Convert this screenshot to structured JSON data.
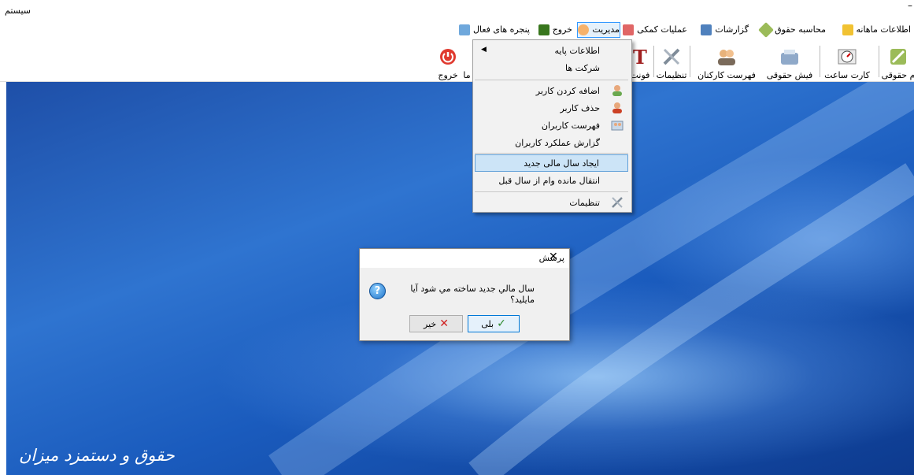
{
  "window": {
    "title": "سيستم",
    "minimize": "–"
  },
  "menu": [
    {
      "label": "اطلاعات ماهانه",
      "icon": "monthly-info-icon",
      "color": "#f1c232"
    },
    {
      "label": "محاسبه حقوق",
      "icon": "salary-calc-icon",
      "color": "#9bbb59"
    },
    {
      "label": "گزارشات",
      "icon": "reports-icon",
      "color": "#4f81bd"
    },
    {
      "label": "عمليات کمکی",
      "icon": "helper-ops-icon",
      "color": "#e06666"
    },
    {
      "label": "مديريت",
      "icon": "management-icon",
      "color": "#f6b26b"
    },
    {
      "label": "خروج",
      "icon": "exit-icon",
      "color": "#38761d"
    },
    {
      "label": "پنجره هاى فعال",
      "icon": "active-windows-icon",
      "color": "#6fa8dc"
    }
  ],
  "toolbar": [
    {
      "label": "م حقوقی",
      "icon": "edit-pencil-icon"
    },
    {
      "label": "کارت ساعت",
      "icon": "time-card-icon"
    },
    {
      "label": "فیش حقوقی",
      "icon": "payslip-icon"
    },
    {
      "label": "فهرست کارکنان",
      "icon": "staff-list-icon"
    },
    {
      "label": "تنظیمات",
      "icon": "settings-tools-icon"
    },
    {
      "label": "فونت",
      "icon": "font-icon"
    },
    {
      "label": "ما",
      "icon": ""
    },
    {
      "label": "خروج",
      "icon": "power-icon"
    }
  ],
  "dropdown": {
    "items": [
      {
        "label": "اطلاعات پايه",
        "submenu": true
      },
      {
        "label": "شرکت ها"
      },
      {
        "label": "اضافه كردن كاربر",
        "icon": "add-user-icon"
      },
      {
        "label": "حذف کاربر",
        "icon": "remove-user-icon"
      },
      {
        "label": "فهرست کاربران",
        "icon": "users-list-icon"
      },
      {
        "label": "گزارش عملکرد کاربران"
      },
      {
        "label": "ايجاد سال مالى جديد",
        "highlighted": true
      },
      {
        "label": "انتقال مانده وام از سال قبل"
      },
      {
        "label": "تنظیمات",
        "icon": "settings-icon"
      }
    ]
  },
  "dialog": {
    "title": "پرسش",
    "message": "سال مالي جديد ساخته مي شود آيا مايليد؟",
    "yes_label": "بلی",
    "no_label": "خیر",
    "close": "✕"
  },
  "desktop": {
    "brand": "حقوق و دستمزد ميزان"
  },
  "colors": {
    "desktop_blue": "#2f74d0",
    "highlight": "#cce4f7",
    "exit_red": "#e03a2f"
  }
}
